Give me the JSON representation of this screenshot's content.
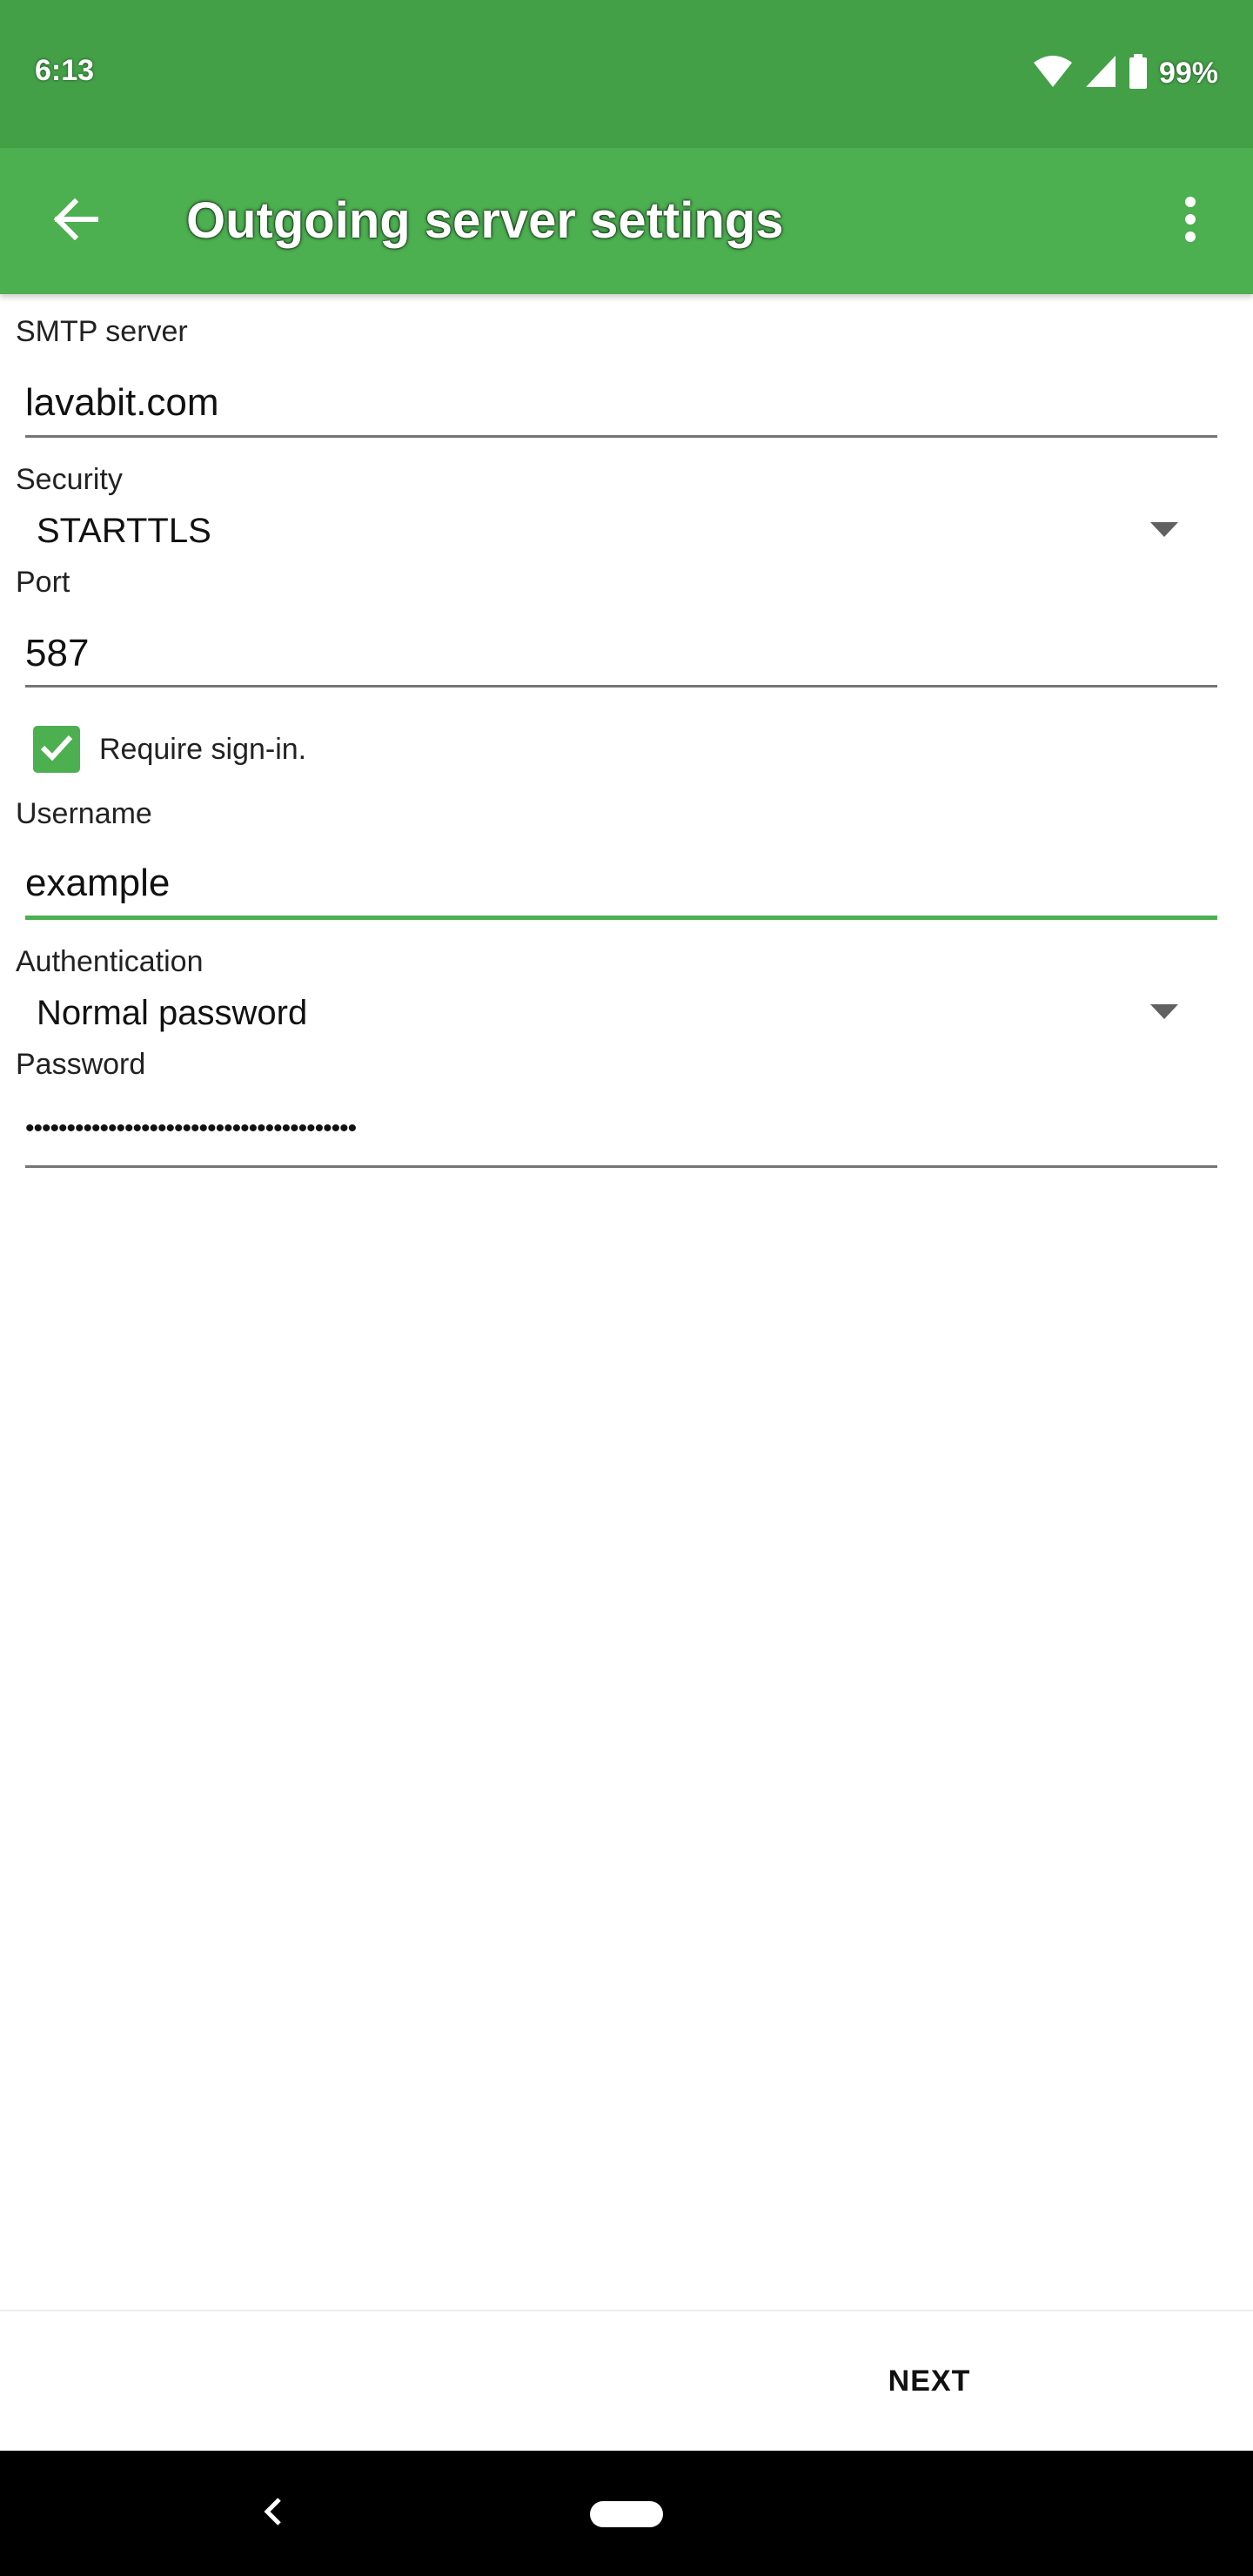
{
  "status_bar": {
    "time": "6:13",
    "battery_percent": "99%",
    "icons": [
      "wifi-icon",
      "cell-signal-icon",
      "battery-icon"
    ]
  },
  "app_bar": {
    "title": "Outgoing server settings",
    "back_icon": "arrow-left-icon",
    "menu_icon": "more-vert-icon"
  },
  "form": {
    "smtp_server": {
      "label": "SMTP server",
      "value": "lavabit.com"
    },
    "security": {
      "label": "Security",
      "value": "STARTTLS"
    },
    "port": {
      "label": "Port",
      "value": "587"
    },
    "require_signin": {
      "label": "Require sign-in.",
      "checked": true
    },
    "username": {
      "label": "Username",
      "value": "example"
    },
    "authentication": {
      "label": "Authentication",
      "value": "Normal password"
    },
    "password": {
      "label": "Password",
      "value": "••••••••••••••••••••••••••••••••••••••••"
    }
  },
  "bottom": {
    "next_label": "NEXT"
  },
  "colors": {
    "status_bar": "#43a047",
    "app_bar": "#4caf50",
    "accent": "#4caf50",
    "nav_bar": "#000000"
  }
}
